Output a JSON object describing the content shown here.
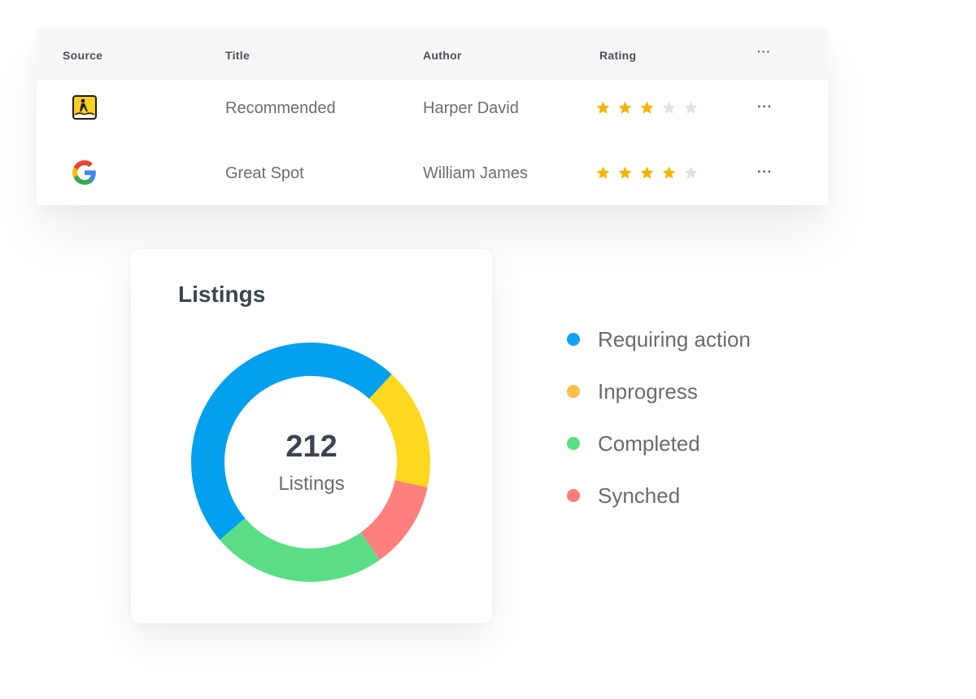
{
  "table": {
    "headers": {
      "source": "Source",
      "title": "Title",
      "author": "Author",
      "rating": "Rating",
      "more": "···"
    },
    "rows": [
      {
        "source": "yellow-pages-icon",
        "title": "Recommended",
        "author": "Harper David",
        "rating": 3,
        "rating_max": 5,
        "more": "···"
      },
      {
        "source": "google-icon",
        "title": "Great Spot",
        "author": "William James",
        "rating": 4,
        "rating_max": 5,
        "more": "···"
      }
    ],
    "star_colors": {
      "filled": "#f5b400",
      "empty": "#e2e2e2"
    }
  },
  "listings": {
    "title": "Listings",
    "total": "212",
    "total_label": "Listings"
  },
  "chart_data": {
    "type": "pie",
    "variant": "donut",
    "title": "Listings",
    "center_text": "212 Listings",
    "total": 212,
    "categories": [
      "Requiring action",
      "Inprogress",
      "Synched",
      "Completed"
    ],
    "values": [
      102,
      35,
      25,
      50
    ],
    "colors": [
      "#03a0f0",
      "#fdd81e",
      "#ff7f7c",
      "#5ade85"
    ],
    "legend": [
      {
        "label": "Requiring action",
        "color": "#14a0f5"
      },
      {
        "label": "Inprogress",
        "color": "#ffbe4d"
      },
      {
        "label": "Completed",
        "color": "#5ade85"
      },
      {
        "label": "Synched",
        "color": "#ff7b7b"
      }
    ],
    "legend_position": "right",
    "start_angle_deg": 229.5
  }
}
